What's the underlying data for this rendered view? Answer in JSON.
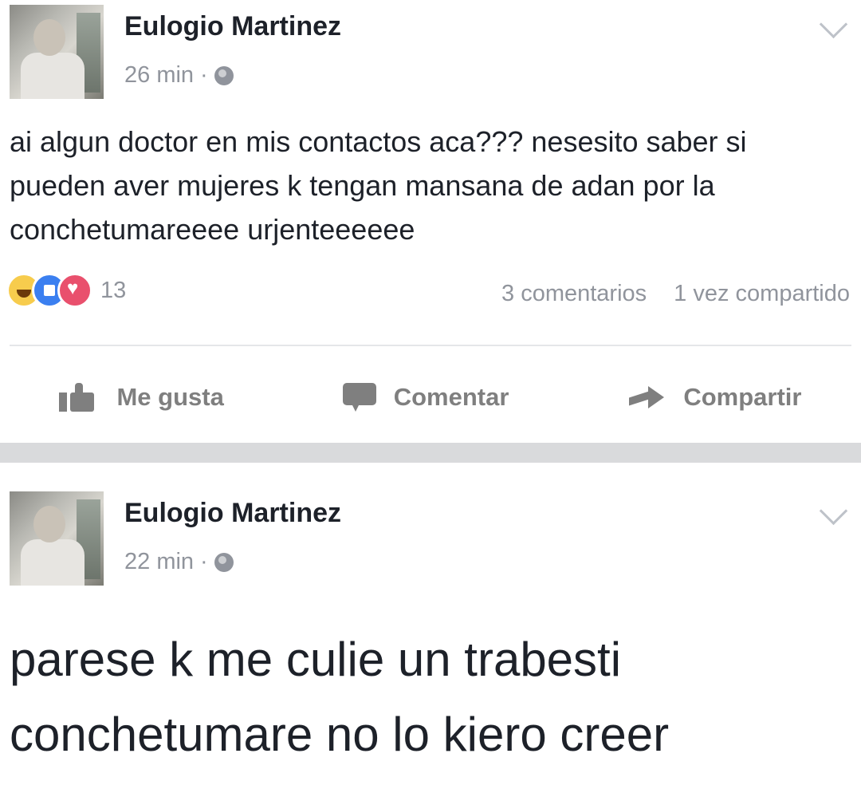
{
  "posts": [
    {
      "author": "Eulogio Martinez",
      "time": "26 min",
      "dot": "·",
      "text": "ai algun doctor en mis contactos aca??? nesesito saber si pueden aver mujeres k tengan mansana de adan por la conchetumareeee urjenteeeeee",
      "reaction_count": "13",
      "comments": "3 comentarios",
      "shares": "1 vez compartido",
      "actions": {
        "like": "Me gusta",
        "comment": "Comentar",
        "share": "Compartir"
      }
    },
    {
      "author": "Eulogio Martinez",
      "time": "22 min",
      "dot": "·",
      "text": "parese k me culie un trabesti conchetumare no lo kiero creer"
    }
  ],
  "colors": {
    "text": "#1d2129",
    "meta": "#90949c",
    "action": "#7f7f7f",
    "separator": "#d9dadc",
    "like_blue": "#3b7ff0",
    "love_red": "#e9506d",
    "haha_yellow": "#f7cc4d"
  },
  "icons": [
    "globe-icon",
    "chevron-down-icon",
    "haha-icon",
    "like-icon",
    "love-icon",
    "thumbs-up-icon",
    "comment-icon",
    "share-icon"
  ]
}
